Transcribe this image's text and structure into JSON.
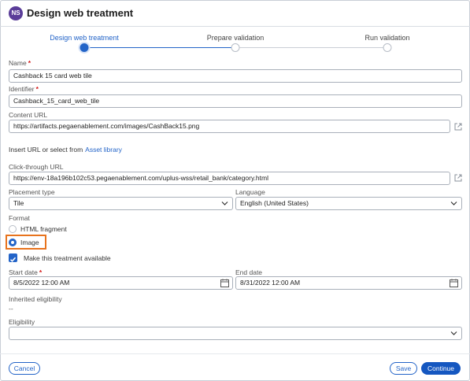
{
  "header": {
    "avatar_initials": "NS",
    "title": "Design web treatment"
  },
  "steps": [
    {
      "label": "Design web treatment",
      "state": "active"
    },
    {
      "label": "Prepare validation",
      "state": "pending"
    },
    {
      "label": "Run validation",
      "state": "pending"
    }
  ],
  "form": {
    "name": {
      "label": "Name",
      "required": "*",
      "value": "Cashback 15 card web tile"
    },
    "identifier": {
      "label": "Identifier",
      "required": "*",
      "value": "Cashback_15_card_web_tile"
    },
    "content_url": {
      "label": "Content URL",
      "value": "https://artifacts.pegaenablement.com/images/CashBack15.png"
    },
    "insert_url": {
      "text": "Insert URL or select from",
      "link": "Asset library"
    },
    "click_through_url": {
      "label": "Click-through URL",
      "value": "https://env-18a196b102c53.pegaenablement.com/uplus-wss/retail_bank/category.html"
    },
    "placement_type": {
      "label": "Placement type",
      "value": "Tile"
    },
    "language": {
      "label": "Language",
      "value": "English (United States)"
    },
    "format": {
      "label": "Format",
      "options": [
        {
          "label": "HTML fragment",
          "checked": false
        },
        {
          "label": "Image",
          "checked": true
        }
      ]
    },
    "available": {
      "label": "Make this treatment available",
      "checked": true
    },
    "start_date": {
      "label": "Start date",
      "required": "*",
      "value": "8/5/2022 12:00 AM"
    },
    "end_date": {
      "label": "End date",
      "value": "8/31/2022 12:00 AM"
    },
    "inherited_eligibility": {
      "label": "Inherited eligibility",
      "value": "--"
    },
    "eligibility": {
      "label": "Eligibility",
      "value": ""
    }
  },
  "footer": {
    "cancel_label": "Cancel",
    "save_label": "Save",
    "continue_label": "Continue"
  },
  "colors": {
    "accent": "#2364c8",
    "highlight": "#e8731d",
    "required": "#d31515",
    "avatar": "#5a3d99"
  }
}
